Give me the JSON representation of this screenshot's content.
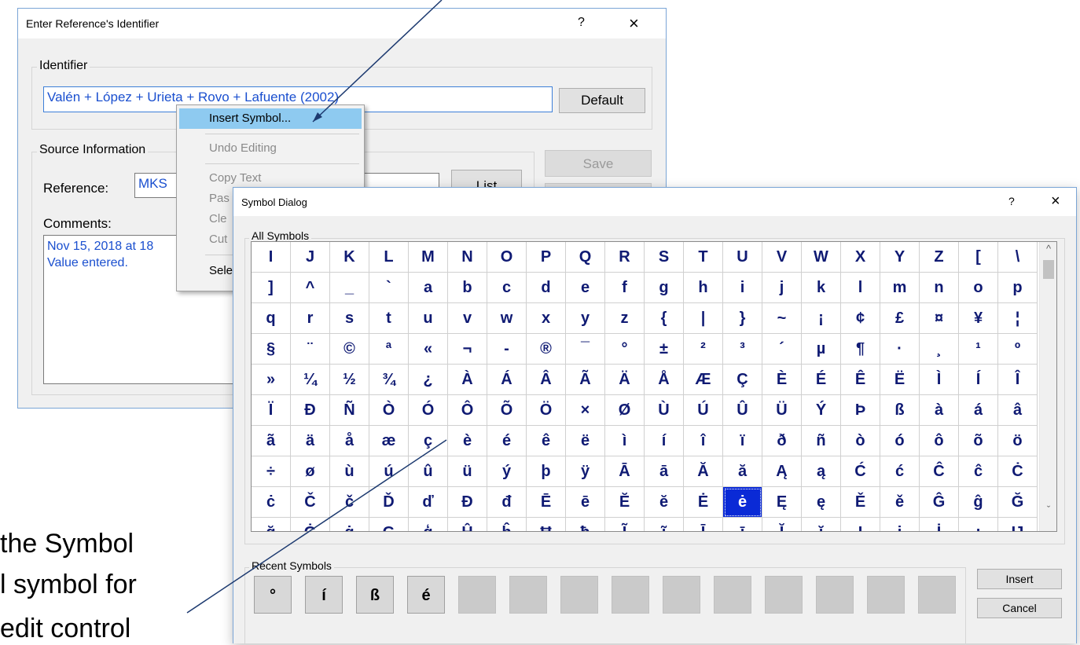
{
  "entry_dialog": {
    "title": "Enter Reference's Identifier",
    "help": "?",
    "close": "×",
    "identifier_group": "Identifier",
    "identifier_value": "Valén + López + Urieta + Rovo + Lafuente (2002)",
    "default_button": "Default",
    "source_group": "Source Information",
    "reference_label": "Reference:",
    "reference_value": "MKS",
    "list_button": "List",
    "save_button": "Save",
    "comments_label": "Comments:",
    "comments_line1": "Nov 15, 2018 at 18",
    "comments_line2": "Value entered."
  },
  "context_menu": {
    "items": [
      "Insert Symbol...",
      "Undo Editing",
      "Copy Text",
      "Pas",
      "Cle",
      "Cut",
      "Sele"
    ]
  },
  "symbol_dialog": {
    "title": "Symbol Dialog",
    "help": "?",
    "close": "×",
    "all_symbols_label": "All Symbols",
    "symbols": [
      "I",
      "J",
      "K",
      "L",
      "M",
      "N",
      "O",
      "P",
      "Q",
      "R",
      "S",
      "T",
      "U",
      "V",
      "W",
      "X",
      "Y",
      "Z",
      "[",
      "\\",
      "]",
      "^",
      "_",
      "`",
      "a",
      "b",
      "c",
      "d",
      "e",
      "f",
      "g",
      "h",
      "i",
      "j",
      "k",
      "l",
      "m",
      "n",
      "o",
      "p",
      "q",
      "r",
      "s",
      "t",
      "u",
      "v",
      "w",
      "x",
      "y",
      "z",
      "{",
      "|",
      "}",
      "~",
      "¡",
      "¢",
      "£",
      "¤",
      "¥",
      "¦",
      "§",
      "¨",
      "©",
      "ª",
      "«",
      "¬",
      "-",
      "®",
      "¯",
      "°",
      "±",
      "²",
      "³",
      "´",
      "µ",
      "¶",
      "·",
      "¸",
      "¹",
      "º",
      "»",
      "¼",
      "½",
      "¾",
      "¿",
      "À",
      "Á",
      "Â",
      "Ã",
      "Ä",
      "Å",
      "Æ",
      "Ç",
      "È",
      "É",
      "Ê",
      "Ë",
      "Ì",
      "Í",
      "Î",
      "Ï",
      "Ð",
      "Ñ",
      "Ò",
      "Ó",
      "Ô",
      "Õ",
      "Ö",
      "×",
      "Ø",
      "Ù",
      "Ú",
      "Û",
      "Ü",
      "Ý",
      "Þ",
      "ß",
      "à",
      "á",
      "â",
      "ã",
      "ä",
      "å",
      "æ",
      "ç",
      "è",
      "é",
      "ê",
      "ë",
      "ì",
      "í",
      "î",
      "ï",
      "ð",
      "ñ",
      "ò",
      "ó",
      "ô",
      "õ",
      "ö",
      "÷",
      "ø",
      "ù",
      "ú",
      "û",
      "ü",
      "ý",
      "þ",
      "ÿ",
      "Ā",
      "ā",
      "Ă",
      "ă",
      "Ą",
      "ą",
      "Ć",
      "ć",
      "Ĉ",
      "ĉ",
      "Ċ",
      "ċ",
      "Č",
      "č",
      "Ď",
      "ď",
      "Đ",
      "đ",
      "Ē",
      "ē",
      "Ĕ",
      "ĕ",
      "Ė",
      "ė",
      "Ę",
      "ę",
      "Ě",
      "ě",
      "Ĝ",
      "ĝ",
      "Ğ",
      "ğ",
      "Ġ",
      "ġ",
      "Ģ",
      "ģ",
      "Ĥ",
      "ĥ",
      "Ħ",
      "ħ",
      "Ĩ",
      "ĩ",
      "Ī",
      "ī",
      "Ĭ",
      "ĭ",
      "Į",
      "į",
      "İ",
      "ı",
      "Ĳ"
    ],
    "selected_symbol": "ė",
    "recent_label": "Recent Symbols",
    "recent_symbols": [
      "°",
      "í",
      "ß",
      "é",
      "",
      "",
      "",
      "",
      "",
      "",
      "",
      "",
      "",
      ""
    ],
    "insert_button": "Insert",
    "cancel_button": "Cancel"
  },
  "annotation": {
    "line1": "the Symbol",
    "line2": "l symbol for",
    "line3": "edit control"
  }
}
